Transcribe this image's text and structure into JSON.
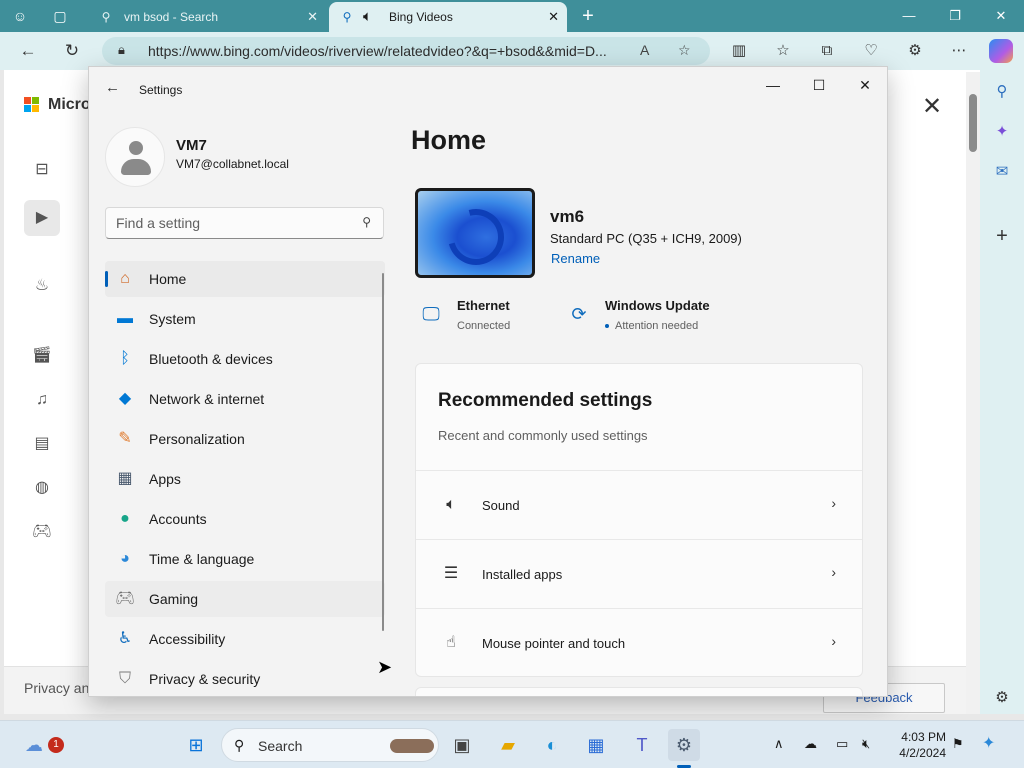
{
  "browser": {
    "tabs": [
      {
        "label": "vm bsod - Search"
      },
      {
        "label": "Bing Videos"
      }
    ],
    "url": "https://www.bing.com/videos/riverview/relatedvideo?&q=+bsod&&mid=D..."
  },
  "bing": {
    "brand": "Micros",
    "footer_privacy": "Privacy an",
    "feedback_label": "Feedback"
  },
  "settings": {
    "window_title": "Settings",
    "user": {
      "name": "VM7",
      "email": "VM7@collabnet.local"
    },
    "search": {
      "placeholder": "Find a setting"
    },
    "nav": [
      {
        "label": "Home",
        "icon": "home-icon"
      },
      {
        "label": "System",
        "icon": "system-icon"
      },
      {
        "label": "Bluetooth & devices",
        "icon": "bluetooth-icon"
      },
      {
        "label": "Network & internet",
        "icon": "network-icon"
      },
      {
        "label": "Personalization",
        "icon": "brush-icon"
      },
      {
        "label": "Apps",
        "icon": "apps-icon"
      },
      {
        "label": "Accounts",
        "icon": "accounts-icon"
      },
      {
        "label": "Time & language",
        "icon": "globe-clock-icon"
      },
      {
        "label": "Gaming",
        "icon": "gamepad-icon"
      },
      {
        "label": "Accessibility",
        "icon": "accessibility-icon"
      },
      {
        "label": "Privacy & security",
        "icon": "shield-icon"
      }
    ],
    "home": {
      "title": "Home",
      "pc_name": "vm6",
      "pc_model": "Standard PC (Q35 + ICH9, 2009)",
      "rename_label": "Rename",
      "ethernet": {
        "title": "Ethernet",
        "status": "Connected"
      },
      "windows_update": {
        "title": "Windows Update",
        "status": "Attention needed"
      },
      "recommended": {
        "title": "Recommended settings",
        "subtitle": "Recent and commonly used settings",
        "items": [
          {
            "label": "Sound",
            "icon": "speaker-icon"
          },
          {
            "label": "Installed apps",
            "icon": "list-icon"
          },
          {
            "label": "Mouse pointer and touch",
            "icon": "pointer-icon"
          }
        ]
      }
    }
  },
  "taskbar": {
    "search_label": "Search",
    "time": "4:03 PM",
    "date": "4/2/2024",
    "weather_badge": "1"
  }
}
